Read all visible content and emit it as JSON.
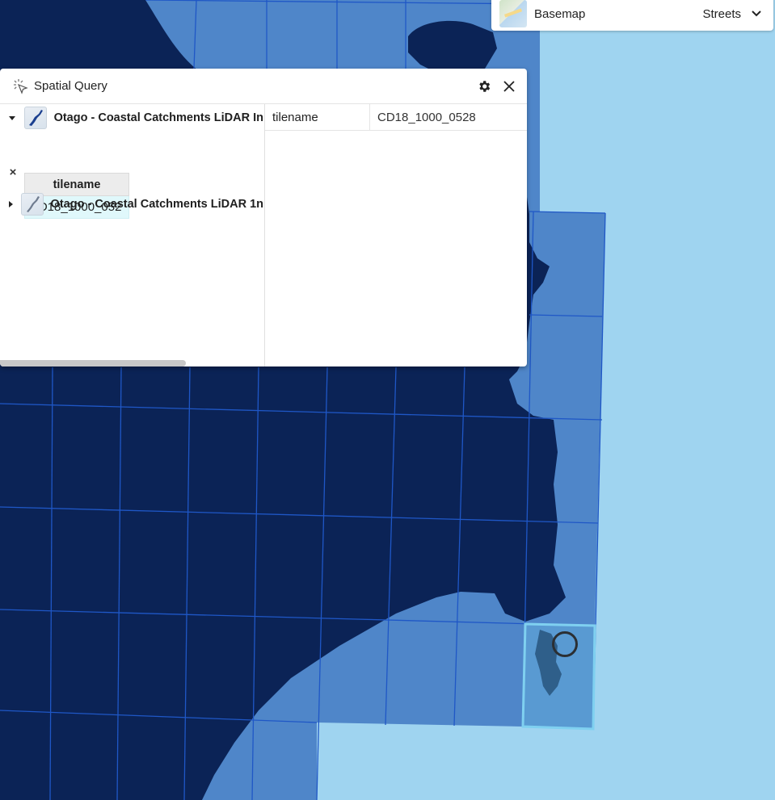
{
  "map": {
    "colors": {
      "water": "#9fd4f0",
      "tile_fill": "#4f86c9",
      "land_dark": "#0b2356",
      "grid_line": "#1f57c6",
      "selected_tile_fill": "#5a9ed4",
      "selected_tile_border": "#7fd0f0"
    }
  },
  "basemap": {
    "label": "Basemap",
    "value": "Streets",
    "thumbnail_icon": "streets-map-thumbnail",
    "chevron_icon": "chevron-down-icon"
  },
  "spatial_query": {
    "title": "Spatial Query",
    "title_icon": "pointer-click-icon",
    "settings_icon": "gear-icon",
    "close_icon": "close-icon",
    "layers": [
      {
        "name": "Otago - Coastal Catchments LiDAR In",
        "expanded": true,
        "expander_icon": "caret-down-icon"
      },
      {
        "name": "Otago - Coastal Catchments LiDAR 1n",
        "expanded": false,
        "expander_icon": "caret-right-icon"
      }
    ],
    "results_table": {
      "header": "tilename",
      "rows": [
        "CD18_1000_052"
      ],
      "remove_glyph": "×"
    },
    "attributes": [
      {
        "key": "tilename",
        "value": "CD18_1000_0528"
      }
    ]
  }
}
